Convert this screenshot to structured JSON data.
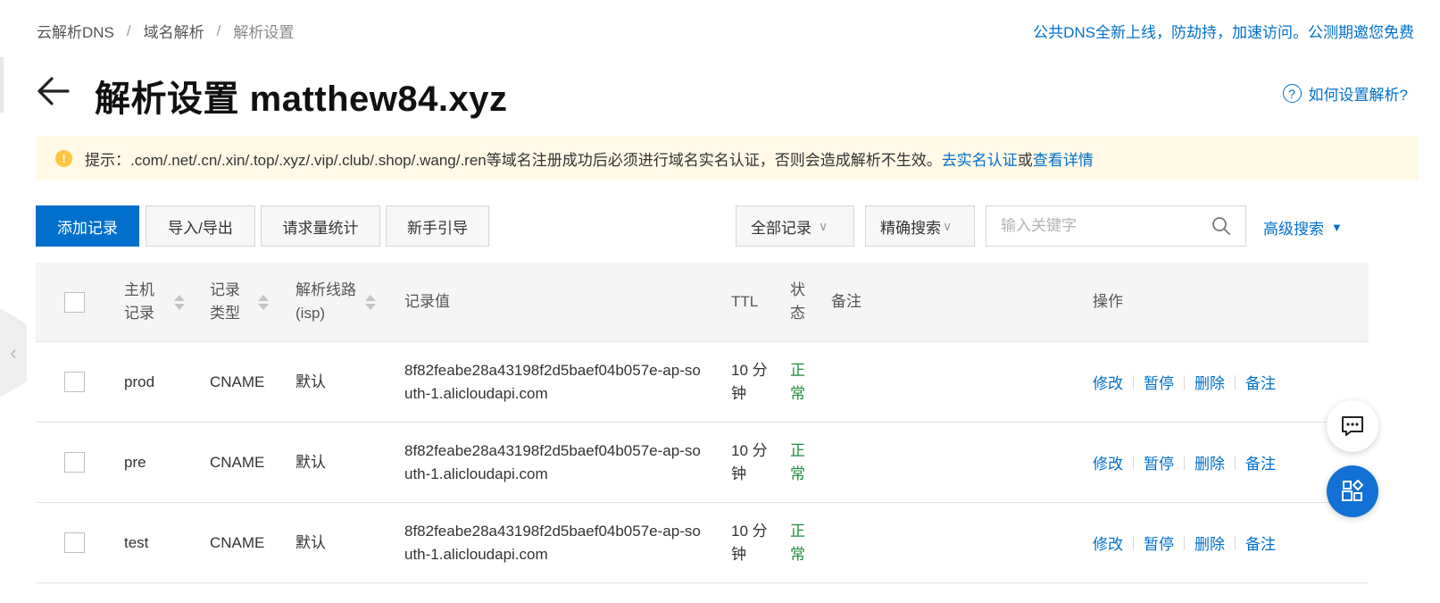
{
  "breadcrumb": {
    "items": [
      "云解析DNS",
      "域名解析",
      "解析设置"
    ],
    "separator": "/"
  },
  "top_notice": "公共DNS全新上线，防劫持，加速访问。公测期邀您免费",
  "title": {
    "prefix": "解析设置",
    "domain": "matthew84.xyz"
  },
  "help_link": "如何设置解析?",
  "alert": {
    "icon": "warning-icon",
    "text": "提示：.com/.net/.cn/.xin/.top/.xyz/.vip/.club/.shop/.wang/.ren等域名注册成功后必须进行域名实名认证，否则会造成解析不生效。",
    "link1": "去实名认证",
    "connector": "或",
    "link2": "查看详情"
  },
  "toolbar": {
    "add_record": "添加记录",
    "import_export": "导入/导出",
    "request_stats": "请求量统计",
    "guide": "新手引导",
    "filter_select": "全部记录",
    "search_mode": "精确搜索",
    "search_placeholder": "输入关键字",
    "advanced_search": "高级搜索"
  },
  "table": {
    "headers": {
      "host_line1": "主机",
      "host_line2": "记录",
      "type_line1": "记录",
      "type_line2": "类型",
      "line_line1": "解析线路",
      "line_line2": "(isp)",
      "value": "记录值",
      "ttl": "TTL",
      "status_line1": "状",
      "status_line2": "态",
      "remark": "备注",
      "actions": "操作"
    },
    "rows": [
      {
        "host": "prod",
        "type": "CNAME",
        "line": "默认",
        "value_line1": "8f82feabe28a43198f2d5baef04b057e-ap-so",
        "value_line2": "uth-1.alicloudapi.com",
        "ttl_line1": "10 分",
        "ttl_line2": "钟",
        "status_line1": "正",
        "status_line2": "常",
        "actions": [
          "修改",
          "暂停",
          "删除",
          "备注"
        ]
      },
      {
        "host": "pre",
        "type": "CNAME",
        "line": "默认",
        "value_line1": "8f82feabe28a43198f2d5baef04b057e-ap-so",
        "value_line2": "uth-1.alicloudapi.com",
        "ttl_line1": "10 分",
        "ttl_line2": "钟",
        "status_line1": "正",
        "status_line2": "常",
        "actions": [
          "修改",
          "暂停",
          "删除",
          "备注"
        ]
      },
      {
        "host": "test",
        "type": "CNAME",
        "line": "默认",
        "value_line1": "8f82feabe28a43198f2d5baef04b057e-ap-so",
        "value_line2": "uth-1.alicloudapi.com",
        "ttl_line1": "10 分",
        "ttl_line2": "钟",
        "status_line1": "正",
        "status_line2": "常",
        "actions": [
          "修改",
          "暂停",
          "删除",
          "备注"
        ]
      }
    ]
  },
  "colors": {
    "primary": "#0070cc",
    "status_ok": "#1e8e3e",
    "alert_bg": "#fff9e6",
    "warning": "#ffc440"
  }
}
